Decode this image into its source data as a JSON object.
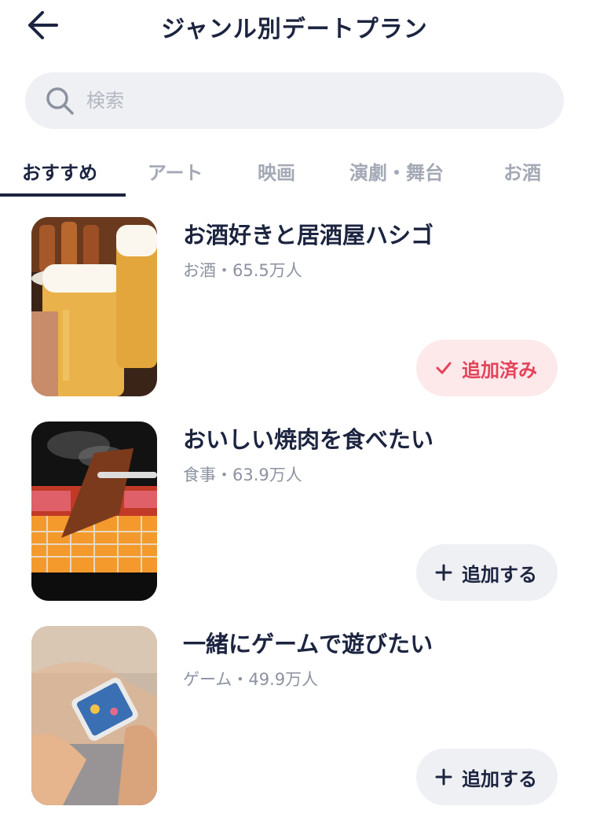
{
  "header": {
    "title": "ジャンル別デートプラン",
    "back_icon": "arrow-left-icon"
  },
  "search": {
    "placeholder": "検索",
    "icon": "search-icon"
  },
  "tabs": [
    {
      "label": "おすすめ",
      "active": true
    },
    {
      "label": "アート",
      "active": false
    },
    {
      "label": "映画",
      "active": false
    },
    {
      "label": "演劇・舞台",
      "active": false
    },
    {
      "label": "お酒",
      "active": false
    }
  ],
  "plans": [
    {
      "title": "お酒好きと居酒屋ハシゴ",
      "meta": "お酒・65.5万人",
      "button_label": "追加済み",
      "button_icon": "check-icon",
      "added": true
    },
    {
      "title": "おいしい焼肉を食べたい",
      "meta": "食事・63.9万人",
      "button_label": "追加する",
      "button_icon": "plus-icon",
      "added": false
    },
    {
      "title": "一緒にゲームで遊びたい",
      "meta": "ゲーム・49.9万人",
      "button_label": "追加する",
      "button_icon": "plus-icon",
      "added": false
    }
  ],
  "colors": {
    "primary_text": "#1c2440",
    "muted_text": "#8c92a0",
    "inactive_tab": "#a4a9b5",
    "search_bg": "#eff0f3",
    "added_bg": "#fde8ea",
    "added_text": "#e4435a"
  }
}
